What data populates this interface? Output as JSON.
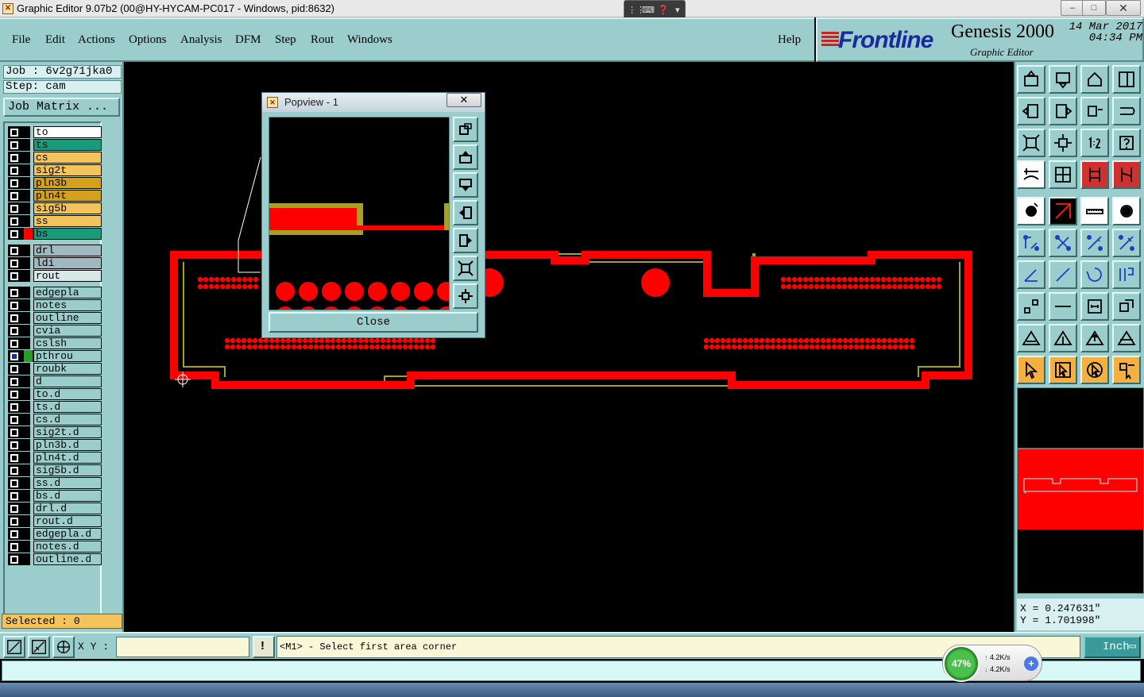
{
  "window": {
    "title": "Graphic Editor 9.07b2 (00@HY-HYCAM-PC017 - Windows, pid:8632)",
    "minimize": "–",
    "maximize": "□",
    "close": "✕"
  },
  "menu": [
    {
      "label": "File"
    },
    {
      "label": "Edit"
    },
    {
      "label": "Actions"
    },
    {
      "label": "Options"
    },
    {
      "label": "Analysis"
    },
    {
      "label": "DFM"
    },
    {
      "label": "Step"
    },
    {
      "label": "Rout"
    },
    {
      "label": "Windows"
    },
    {
      "label": "Help"
    }
  ],
  "logo": {
    "brand": "Frontline",
    "product": "Genesis 2000",
    "subtitle": "Graphic Editor",
    "date": "14 Mar 2017",
    "time": "04:34 PM"
  },
  "job": {
    "job_line": "Job : 6v2g71jka0",
    "step_line": "Step: cam",
    "matrix_button": "Job Matrix ..."
  },
  "layers": [
    {
      "name": "to",
      "color": "#ffffff",
      "mark": ""
    },
    {
      "name": "ts",
      "color": "#1a9a7a",
      "mark": ""
    },
    {
      "name": "cs",
      "color": "#f4c45c",
      "mark": ""
    },
    {
      "name": "sig2t",
      "color": "#f4c45c",
      "mark": ""
    },
    {
      "name": "pln3b",
      "color": "#d4a020",
      "mark": ""
    },
    {
      "name": "pln4t",
      "color": "#d4a020",
      "mark": ""
    },
    {
      "name": "sig5b",
      "color": "#f4c45c",
      "mark": ""
    },
    {
      "name": "ss",
      "color": "#f4c45c",
      "mark": ""
    },
    {
      "name": "bs",
      "color": "#1a9a7a",
      "mark": "#ff0000"
    },
    {
      "name": "drl",
      "color": "#a0b8c0",
      "mark": ""
    },
    {
      "name": "ldi",
      "color": "#a0b8c0",
      "mark": ""
    },
    {
      "name": "rout",
      "color": "#d8e8e8",
      "mark": ""
    },
    {
      "name": "edgepla",
      "color": "#9ccdcd",
      "mark": ""
    },
    {
      "name": "notes",
      "color": "#9ccdcd",
      "mark": ""
    },
    {
      "name": "outline",
      "color": "#9ccdcd",
      "mark": ""
    },
    {
      "name": "cvia",
      "color": "#9ccdcd",
      "mark": ""
    },
    {
      "name": "cslsh",
      "color": "#9ccdcd",
      "mark": ""
    },
    {
      "name": "pthrou",
      "color": "#9ccdcd",
      "mark": "#2a9a2a",
      "active": true
    },
    {
      "name": "roubk",
      "color": "#9ccdcd",
      "mark": ""
    },
    {
      "name": "d",
      "color": "#9ccdcd",
      "mark": ""
    },
    {
      "name": "to.d",
      "color": "#9ccdcd",
      "mark": ""
    },
    {
      "name": "ts.d",
      "color": "#9ccdcd",
      "mark": ""
    },
    {
      "name": "cs.d",
      "color": "#9ccdcd",
      "mark": ""
    },
    {
      "name": "sig2t.d",
      "color": "#9ccdcd",
      "mark": ""
    },
    {
      "name": "pln3b.d",
      "color": "#9ccdcd",
      "mark": ""
    },
    {
      "name": "pln4t.d",
      "color": "#9ccdcd",
      "mark": ""
    },
    {
      "name": "sig5b.d",
      "color": "#9ccdcd",
      "mark": ""
    },
    {
      "name": "ss.d",
      "color": "#9ccdcd",
      "mark": ""
    },
    {
      "name": "bs.d",
      "color": "#9ccdcd",
      "mark": ""
    },
    {
      "name": "drl.d",
      "color": "#9ccdcd",
      "mark": ""
    },
    {
      "name": "rout.d",
      "color": "#9ccdcd",
      "mark": ""
    },
    {
      "name": "edgepla.d",
      "color": "#9ccdcd",
      "mark": ""
    },
    {
      "name": "notes.d",
      "color": "#9ccdcd",
      "mark": ""
    },
    {
      "name": "outline.d",
      "color": "#9ccdcd",
      "mark": ""
    }
  ],
  "selected_text": "Selected : 0",
  "popview": {
    "title": "Popview - 1",
    "close_label": "Close"
  },
  "coords": {
    "x": "X = 0.247631\"",
    "y": "Y = 1.701998\""
  },
  "bottom": {
    "xy_label": "X Y :",
    "xy_value": "",
    "message": "<M1> - Select first area corner",
    "unit": "Inch"
  },
  "network": {
    "percent": "47%",
    "up": "4.2K/s",
    "down": "4.2K/s"
  },
  "colors": {
    "panel": "#9ccdcd",
    "copper": "#ff0000",
    "outline": "#a8a020"
  }
}
